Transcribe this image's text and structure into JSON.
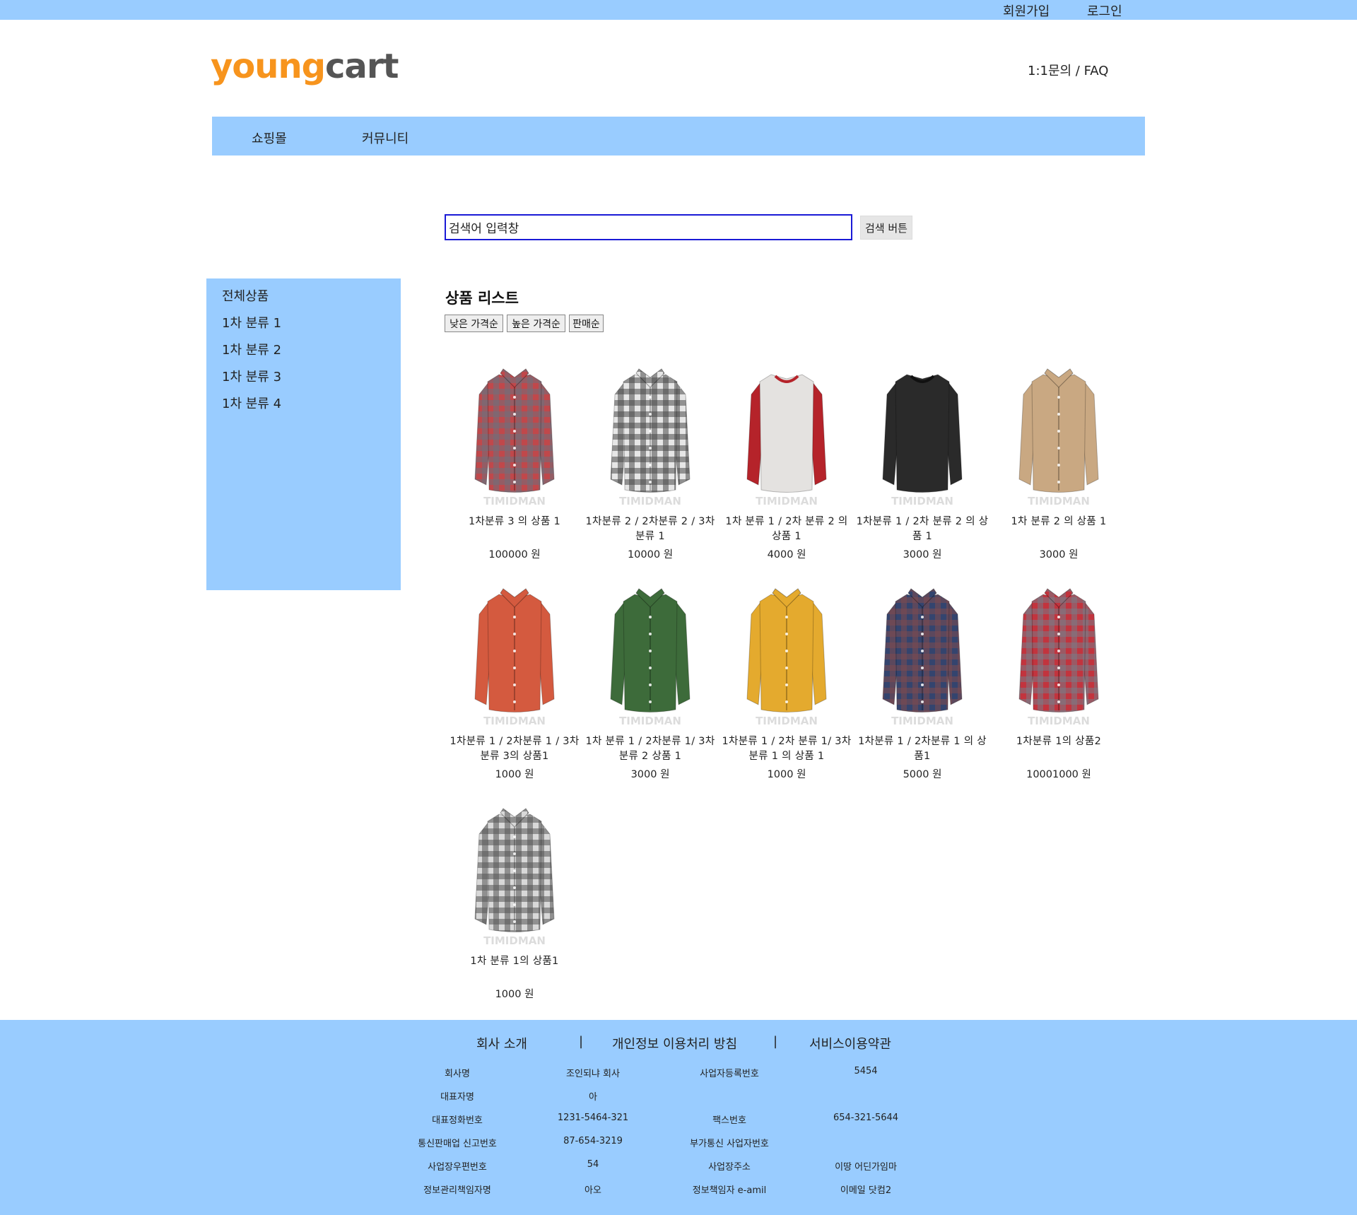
{
  "topbar": {
    "signup": "회원가입",
    "login": "로그인"
  },
  "logo": {
    "part1": "young",
    "part2": "cart"
  },
  "header": {
    "qa_faq": "1:1문의 / FAQ"
  },
  "gnb": {
    "shop": "쇼핑몰",
    "community": "커뮤니티"
  },
  "search": {
    "value": "검색어 입력창",
    "button": "검색 버튼"
  },
  "sidebar": {
    "items": [
      "전체상품",
      "1차 분류 1",
      "1차 분류 2",
      "1차 분류 3",
      "1차 분류 4"
    ]
  },
  "product_list": {
    "title": "상품 리스트",
    "sort": [
      "낮은 가격순",
      "높은 가격순",
      "판매순"
    ],
    "items": [
      {
        "name": "1차분류 3 의 상품 1",
        "price": "100000 원",
        "shirt": "plaid",
        "colors": [
          "#c0484b",
          "#6f6f7a"
        ]
      },
      {
        "name": "1차분류 2 / 2차분류 2 / 3차분류 1",
        "price": "10000 원",
        "shirt": "plaid",
        "colors": [
          "#e6e6e6",
          "#4a4a4a"
        ]
      },
      {
        "name": "1차 분류 1 / 2차 분류 2 의 상품 1",
        "price": "4000 원",
        "shirt": "raglan",
        "colors": [
          "#e4e2e0",
          "#b5232a"
        ]
      },
      {
        "name": "1차분류 1 / 2차 분류 2 의 상품 1",
        "price": "3000 원",
        "shirt": "tee",
        "colors": [
          "#2a2a2a",
          "#1a1a1a"
        ]
      },
      {
        "name": "1차 분류 2 의 상품 1",
        "price": "3000 원",
        "shirt": "solid",
        "colors": [
          "#c9a882",
          "#b3926a"
        ]
      },
      {
        "name": "1차분류 1 / 2차분류 1 / 3차분류 3의 상품1",
        "price": "1000 원",
        "shirt": "solid",
        "colors": [
          "#d45a3f",
          "#b8462e"
        ]
      },
      {
        "name": "1차 분류 1 / 2차분류 1/ 3차 분류 2 상품 1",
        "price": "3000 원",
        "shirt": "solid",
        "colors": [
          "#3d6b3a",
          "#2c5229"
        ]
      },
      {
        "name": "1차분류 1 / 2차 분류 1/ 3차 분류 1 의 상품 1",
        "price": "1000 원",
        "shirt": "solid",
        "colors": [
          "#e4aa2e",
          "#c78f1c"
        ]
      },
      {
        "name": "1차분류 1 / 2차분류 1 의 상품1",
        "price": "5000 원",
        "shirt": "plaid",
        "colors": [
          "#34446e",
          "#7d4a4e"
        ]
      },
      {
        "name": "1차분류 1의 상품2",
        "price": "10001000 원",
        "shirt": "plaid",
        "colors": [
          "#c2343e",
          "#7a7a84"
        ]
      },
      {
        "name": "1차 분류 1의 상품1",
        "price": "1000 원",
        "shirt": "plaid",
        "colors": [
          "#d8d8d8",
          "#555555"
        ]
      }
    ]
  },
  "thumb_watermark": "TIMIDMAN",
  "footer": {
    "links": [
      "회사 소개",
      "개인정보 이용처리 방침",
      "서비스이용약관"
    ],
    "separator": "|",
    "info": [
      [
        "회사명",
        "조인되냐 회사",
        "사업자등록번호",
        "5454"
      ],
      [
        "대표자명",
        "아",
        "",
        ""
      ],
      [
        "대표정화번호",
        "1231-5464-321",
        "팩스번호",
        "654-321-5644"
      ],
      [
        "통신판매업 신고번호",
        "87-654-3219",
        "부가통신 사업자번호",
        ""
      ],
      [
        "사업장우편번호",
        "54",
        "사업장주소",
        "이땅 어딘가임마"
      ],
      [
        "정보관리책임자명",
        "아오",
        "정보책임자 e-amil",
        "이메일 닷컴2"
      ]
    ]
  }
}
